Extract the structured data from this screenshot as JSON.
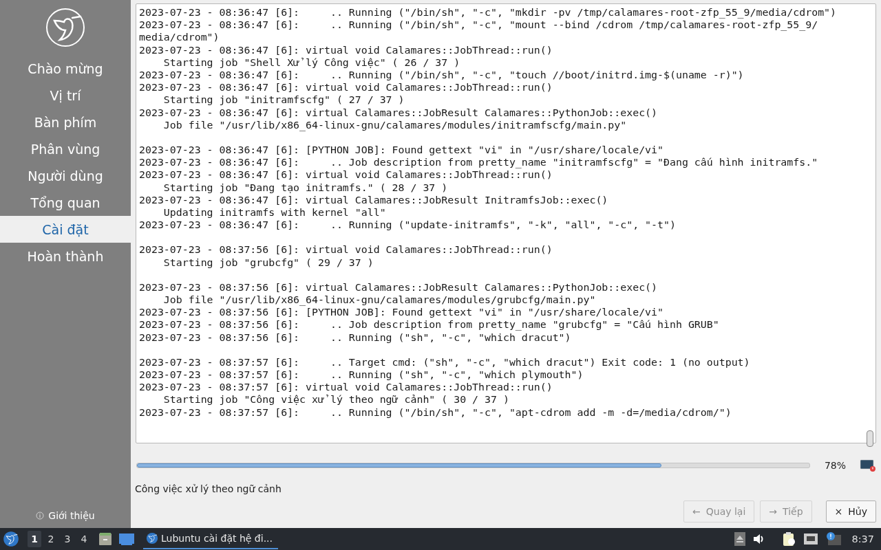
{
  "sidebar": {
    "items": [
      {
        "label": "Chào mừng",
        "selected": false
      },
      {
        "label": "Vị trí",
        "selected": false
      },
      {
        "label": "Bàn phím",
        "selected": false
      },
      {
        "label": "Phân vùng",
        "selected": false
      },
      {
        "label": "Người dùng",
        "selected": false
      },
      {
        "label": "Tổng quan",
        "selected": false
      },
      {
        "label": "Cài đặt",
        "selected": true
      },
      {
        "label": "Hoàn thành",
        "selected": false
      }
    ],
    "about": "Giới thiệu"
  },
  "log": {
    "blocks": [
      [
        "2023-07-23 - 08:36:47 [6]:     .. Running (\"/bin/sh\", \"-c\", \"mkdir -pv /tmp/calamares-root-zfp_55_9/media/cdrom\")",
        "2023-07-23 - 08:36:47 [6]:     .. Running (\"/bin/sh\", \"-c\", \"mount --bind /cdrom /tmp/calamares-root-zfp_55_9/",
        "media/cdrom\")",
        "2023-07-23 - 08:36:47 [6]: virtual void Calamares::JobThread::run()",
        "    Starting job \"Shell Xử lý Công việc\" ( 26 / 37 )",
        "2023-07-23 - 08:36:47 [6]:     .. Running (\"/bin/sh\", \"-c\", \"touch //boot/initrd.img-$(uname -r)\")",
        "2023-07-23 - 08:36:47 [6]: virtual void Calamares::JobThread::run()",
        "    Starting job \"initramfscfg\" ( 27 / 37 )",
        "2023-07-23 - 08:36:47 [6]: virtual Calamares::JobResult Calamares::PythonJob::exec()",
        "    Job file \"/usr/lib/x86_64-linux-gnu/calamares/modules/initramfscfg/main.py\""
      ],
      [
        "2023-07-23 - 08:36:47 [6]: [PYTHON JOB]: Found gettext \"vi\" in \"/usr/share/locale/vi\"",
        "2023-07-23 - 08:36:47 [6]:     .. Job description from pretty_name \"initramfscfg\" = \"Đang cấu hình initramfs.\"",
        "2023-07-23 - 08:36:47 [6]: virtual void Calamares::JobThread::run()",
        "    Starting job \"Đang tạo initramfs.\" ( 28 / 37 )",
        "2023-07-23 - 08:36:47 [6]: virtual Calamares::JobResult InitramfsJob::exec()",
        "    Updating initramfs with kernel \"all\"",
        "2023-07-23 - 08:36:47 [6]:     .. Running (\"update-initramfs\", \"-k\", \"all\", \"-c\", \"-t\")"
      ],
      [
        "2023-07-23 - 08:37:56 [6]: virtual void Calamares::JobThread::run()",
        "    Starting job \"grubcfg\" ( 29 / 37 )"
      ],
      [
        "2023-07-23 - 08:37:56 [6]: virtual Calamares::JobResult Calamares::PythonJob::exec()",
        "    Job file \"/usr/lib/x86_64-linux-gnu/calamares/modules/grubcfg/main.py\"",
        "2023-07-23 - 08:37:56 [6]: [PYTHON JOB]: Found gettext \"vi\" in \"/usr/share/locale/vi\"",
        "2023-07-23 - 08:37:56 [6]:     .. Job description from pretty_name \"grubcfg\" = \"Cấu hình GRUB\"",
        "2023-07-23 - 08:37:56 [6]:     .. Running (\"sh\", \"-c\", \"which dracut\")"
      ],
      [
        "2023-07-23 - 08:37:57 [6]:     .. Target cmd: (\"sh\", \"-c\", \"which dracut\") Exit code: 1 (no output)",
        "2023-07-23 - 08:37:57 [6]:     .. Running (\"sh\", \"-c\", \"which plymouth\")",
        "2023-07-23 - 08:37:57 [6]: virtual void Calamares::JobThread::run()",
        "    Starting job \"Công việc xử lý theo ngữ cảnh\" ( 30 / 37 )",
        "2023-07-23 - 08:37:57 [6]:     .. Running (\"/bin/sh\", \"-c\", \"apt-cdrom add -m -d=/media/cdrom/\")"
      ]
    ]
  },
  "progress": {
    "level": 0.78,
    "reading": "78%"
  },
  "status": "Công việc xử lý theo ngữ cảnh",
  "buttons": [
    {
      "kind": "back",
      "icon": "←",
      "label": "Quay lại",
      "disabled": true
    },
    {
      "kind": "next",
      "icon": "→",
      "label": "Tiếp",
      "disabled": true
    },
    {
      "kind": "cancel",
      "icon": "×",
      "label": "Hủy",
      "disabled": false
    }
  ],
  "taskbar": {
    "workspaces": [
      {
        "label": "1",
        "selected": true
      },
      {
        "label": "2",
        "selected": false
      },
      {
        "label": "3",
        "selected": false
      },
      {
        "label": "4",
        "selected": false
      }
    ],
    "tasks": [
      {
        "label": "Lubuntu cài đặt hệ đi...",
        "selected": true
      }
    ],
    "clock": "8:37"
  }
}
